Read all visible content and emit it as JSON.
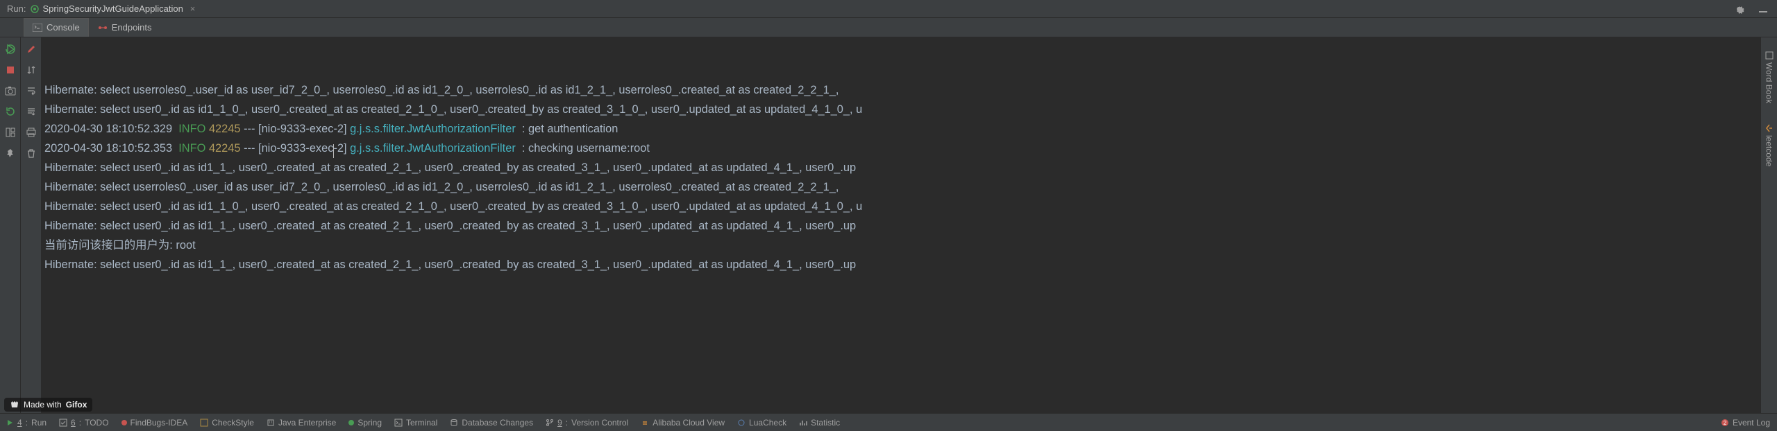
{
  "header": {
    "run_label": "Run:",
    "config_name": "SpringSecurityJwtGuideApplication"
  },
  "tabs": {
    "console": "Console",
    "endpoints": "Endpoints"
  },
  "console_lines": [
    {
      "text": "Hibernate: select userroles0_.user_id as user_id7_2_0_, userroles0_.id as id1_2_0_, userroles0_.id as id1_2_1_, userroles0_.created_at as created_2_2_1_,"
    },
    {
      "text": "Hibernate: select user0_.id as id1_1_0_, user0_.created_at as created_2_1_0_, user0_.created_by as created_3_1_0_, user0_.updated_at as updated_4_1_0_, u"
    },
    {
      "ts": "2020-04-30 18:10:52.329",
      "level": "INFO",
      "pid": "42245",
      "thread": "[nio-9333-exec-2]",
      "cls": "g.j.s.s.filter.JwtAuthorizationFilter",
      "msg": "get authentication"
    },
    {
      "ts": "2020-04-30 18:10:52.353",
      "level": "INFO",
      "pid": "42245",
      "thread": "[nio-9333-exec-2]",
      "cls": "g.j.s.s.filter.JwtAuthorizationFilter",
      "msg": "checking username:root"
    },
    {
      "text": "Hibernate: select user0_.id as id1_1_, user0_.created_at as created_2_1_, user0_.created_by as created_3_1_, user0_.updated_at as updated_4_1_, user0_.up"
    },
    {
      "text": "Hibernate: select userroles0_.user_id as user_id7_2_0_, userroles0_.id as id1_2_0_, userroles0_.id as id1_2_1_, userroles0_.created_at as created_2_2_1_,"
    },
    {
      "text": "Hibernate: select user0_.id as id1_1_0_, user0_.created_at as created_2_1_0_, user0_.created_by as created_3_1_0_, user0_.updated_at as updated_4_1_0_, u"
    },
    {
      "text": "Hibernate: select user0_.id as id1_1_, user0_.created_at as created_2_1_, user0_.created_by as created_3_1_, user0_.updated_at as updated_4_1_, user0_.up"
    },
    {
      "text": "当前访问该接口的用户为: root"
    },
    {
      "text": "Hibernate: select user0_.id as id1_1_, user0_.created_at as created_2_1_, user0_.created_by as created_3_1_, user0_.updated_at as updated_4_1_, user0_.up"
    }
  ],
  "right_gutter": {
    "wordbook": "Word Book",
    "leetcode": "leetcode"
  },
  "status": {
    "run_num": "4",
    "run": "Run",
    "todo_num": "6",
    "todo": "TODO",
    "findbugs": "FindBugs-IDEA",
    "checkstyle": "CheckStyle",
    "java_enterprise": "Java Enterprise",
    "spring": "Spring",
    "terminal": "Terminal",
    "db_changes": "Database Changes",
    "vcs_num": "9",
    "vcs": "Version Control",
    "alibaba": "Alibaba Cloud View",
    "luacheck": "LuaCheck",
    "statistic": "Statistic",
    "eventlog_num": "2",
    "eventlog": "Event Log"
  },
  "gifox": {
    "prefix": "Made with",
    "brand": "Gifox"
  }
}
